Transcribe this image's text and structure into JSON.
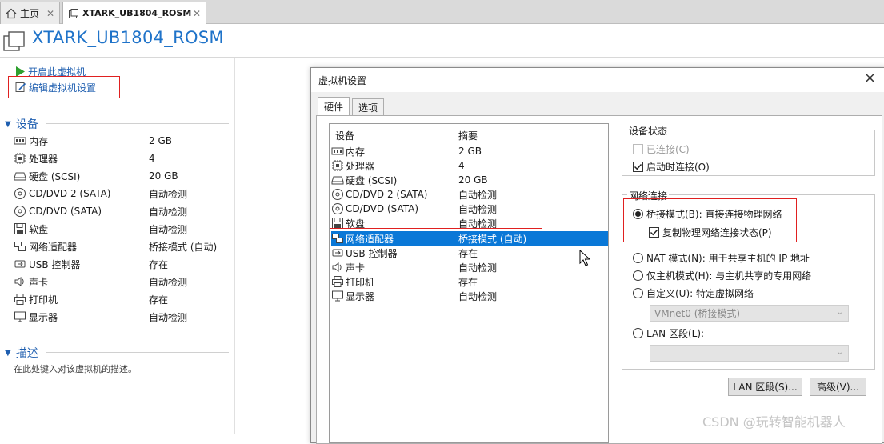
{
  "tabs": [
    {
      "label": "主页",
      "icon": "home-icon"
    },
    {
      "label": "XTARK_UB1804_ROSM",
      "icon": "vm-icon"
    }
  ],
  "page_title": "XTARK_UB1804_ROSM",
  "actions": {
    "power_on": "开启此虚拟机",
    "edit_settings": "编辑虚拟机设置"
  },
  "devices_section": {
    "title": "设备",
    "items": [
      {
        "name": "内存",
        "value": "2 GB",
        "icon": "memory-icon"
      },
      {
        "name": "处理器",
        "value": "4",
        "icon": "cpu-icon"
      },
      {
        "name": "硬盘 (SCSI)",
        "value": "20 GB",
        "icon": "hdd-icon"
      },
      {
        "name": "CD/DVD 2 (SATA)",
        "value": "自动检测",
        "icon": "cd-icon"
      },
      {
        "name": "CD/DVD (SATA)",
        "value": "自动检测",
        "icon": "cd-icon"
      },
      {
        "name": "软盘",
        "value": "自动检测",
        "icon": "floppy-icon"
      },
      {
        "name": "网络适配器",
        "value": "桥接模式 (自动)",
        "icon": "network-icon"
      },
      {
        "name": "USB 控制器",
        "value": "存在",
        "icon": "usb-icon"
      },
      {
        "name": "声卡",
        "value": "自动检测",
        "icon": "sound-icon"
      },
      {
        "name": "打印机",
        "value": "存在",
        "icon": "printer-icon"
      },
      {
        "name": "显示器",
        "value": "自动检测",
        "icon": "display-icon"
      }
    ]
  },
  "description_section": {
    "title": "描述",
    "hint": "在此处键入对该虚拟机的描述。"
  },
  "dialog": {
    "title": "虚拟机设置",
    "close": "×",
    "tabs": [
      "硬件",
      "选项"
    ],
    "list_headers": {
      "device": "设备",
      "summary": "摘要"
    },
    "devices": [
      {
        "name": "内存",
        "value": "2 GB",
        "icon": "memory-icon"
      },
      {
        "name": "处理器",
        "value": "4",
        "icon": "cpu-icon"
      },
      {
        "name": "硬盘 (SCSI)",
        "value": "20 GB",
        "icon": "hdd-icon"
      },
      {
        "name": "CD/DVD 2 (SATA)",
        "value": "自动检测",
        "icon": "cd-icon"
      },
      {
        "name": "CD/DVD (SATA)",
        "value": "自动检测",
        "icon": "cd-icon"
      },
      {
        "name": "软盘",
        "value": "自动检测",
        "icon": "floppy-icon"
      },
      {
        "name": "网络适配器",
        "value": "桥接模式 (自动)",
        "icon": "network-icon",
        "selected": true
      },
      {
        "name": "USB 控制器",
        "value": "存在",
        "icon": "usb-icon"
      },
      {
        "name": "声卡",
        "value": "自动检测",
        "icon": "sound-icon"
      },
      {
        "name": "打印机",
        "value": "存在",
        "icon": "printer-icon"
      },
      {
        "name": "显示器",
        "value": "自动检测",
        "icon": "display-icon"
      }
    ],
    "device_status": {
      "title": "设备状态",
      "connected": {
        "label": "已连接(C)",
        "checked": false,
        "disabled": true
      },
      "connect_on_power": {
        "label": "启动时连接(O)",
        "checked": true
      }
    },
    "network_connection": {
      "title": "网络连接",
      "bridged": {
        "label": "桥接模式(B): 直接连接物理网络",
        "selected": true
      },
      "replicate": {
        "label": "复制物理网络连接状态(P)",
        "checked": true
      },
      "nat": {
        "label": "NAT 模式(N): 用于共享主机的 IP 地址"
      },
      "host_only": {
        "label": "仅主机模式(H): 与主机共享的专用网络"
      },
      "custom": {
        "label": "自定义(U): 特定虚拟网络"
      },
      "custom_combo": "VMnet0 (桥接模式)",
      "lan": {
        "label": "LAN 区段(L):"
      },
      "lan_combo": ""
    },
    "buttons": {
      "lan_segments": "LAN 区段(S)...",
      "advanced": "高级(V)..."
    }
  },
  "watermark": "CSDN @玩转智能机器人",
  "colors": {
    "accent": "#1f73c9",
    "selection": "#0a78d7",
    "highlight_box": "#e02020"
  }
}
